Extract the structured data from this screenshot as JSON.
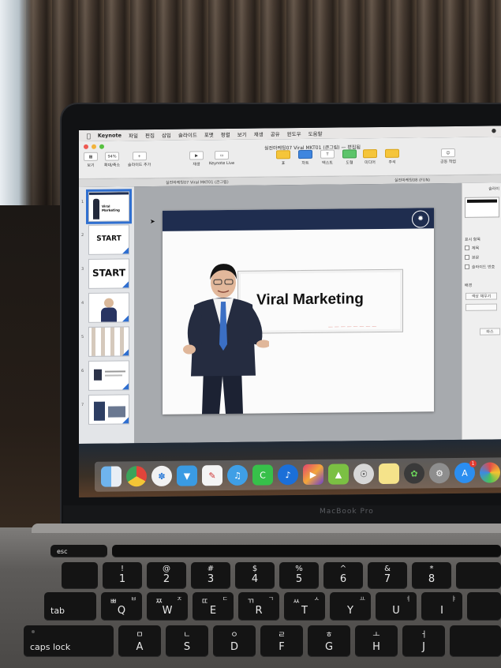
{
  "menubar": {
    "app": "Keynote",
    "items": [
      "파일",
      "편집",
      "삽입",
      "슬라이드",
      "포맷",
      "정렬",
      "보기",
      "재생",
      "공유",
      "윈도우",
      "도움말"
    ]
  },
  "toolbar": {
    "document_title": "실전마케팅07 Viral MKT01 (큰그림) — 편집됨",
    "view_label": "보기",
    "zoom_value": "94%",
    "zoom_label": "확대/축소",
    "add_slide_label": "슬라이드 추가",
    "play_label": "재생",
    "keynote_live_label": "Keynote Live",
    "table_label": "표",
    "chart_label": "차트",
    "text_label": "텍스트",
    "shape_label": "도형",
    "media_label": "미디어",
    "comment_label": "주석",
    "collaborate_label": "공동 작업"
  },
  "tabs": [
    "실전마케팅07 Viral MKT01 (큰그림)",
    "실전마케팅08 (FUN)"
  ],
  "navigator": {
    "slides": [
      {
        "num": "1",
        "label": "Viral Marketing"
      },
      {
        "num": "2",
        "label": "START"
      },
      {
        "num": "3",
        "label": "START"
      },
      {
        "num": "4",
        "label": ""
      },
      {
        "num": "5",
        "label": ""
      },
      {
        "num": "6",
        "label": ""
      },
      {
        "num": "7",
        "label": ""
      }
    ]
  },
  "slide": {
    "title": "Viral Marketing"
  },
  "inspector": {
    "tab": "슬라이",
    "section_show": "표시 항목",
    "check_title": "제목",
    "check_body": "본문",
    "check_number": "슬라이드 번호",
    "section_background": "배경",
    "fill_button": "색상 채우기",
    "edit_button": "마스"
  },
  "hardware": {
    "brand": "MacBook Pro"
  },
  "keyboard": {
    "esc": "esc",
    "tab": "tab",
    "caps": "caps lock",
    "num_row": [
      {
        "s": "!",
        "m": "1"
      },
      {
        "s": "@",
        "m": "2"
      },
      {
        "s": "#",
        "m": "3"
      },
      {
        "s": "$",
        "m": "4"
      },
      {
        "s": "%",
        "m": "5"
      },
      {
        "s": "^",
        "m": "6"
      },
      {
        "s": "&",
        "m": "7"
      },
      {
        "s": "*",
        "m": "8"
      }
    ],
    "q_row": [
      {
        "h": "ㅃ",
        "hm": "ㅂ",
        "m": "Q"
      },
      {
        "h": "ㅉ",
        "hm": "ㅈ",
        "m": "W"
      },
      {
        "h": "ㄸ",
        "hm": "ㄷ",
        "m": "E"
      },
      {
        "h": "ㄲ",
        "hm": "ㄱ",
        "m": "R"
      },
      {
        "h": "ㅆ",
        "hm": "ㅅ",
        "m": "T"
      },
      {
        "h": "",
        "hm": "ㅛ",
        "m": "Y"
      },
      {
        "h": "",
        "hm": "ㅕ",
        "m": "U"
      },
      {
        "h": "",
        "hm": "ㅑ",
        "m": "I"
      }
    ],
    "a_row": [
      {
        "hm": "ㅁ",
        "m": "A"
      },
      {
        "hm": "ㄴ",
        "m": "S"
      },
      {
        "hm": "ㅇ",
        "m": "D"
      },
      {
        "hm": "ㄹ",
        "m": "F"
      },
      {
        "hm": "ㅎ",
        "m": "G"
      },
      {
        "hm": "ㅗ",
        "m": "H"
      },
      {
        "hm": "ㅓ",
        "m": "J"
      }
    ]
  },
  "colors": {
    "accent": "#2f6fd0",
    "slide_band": "#1f2d4f",
    "badge": "#e23b32"
  }
}
